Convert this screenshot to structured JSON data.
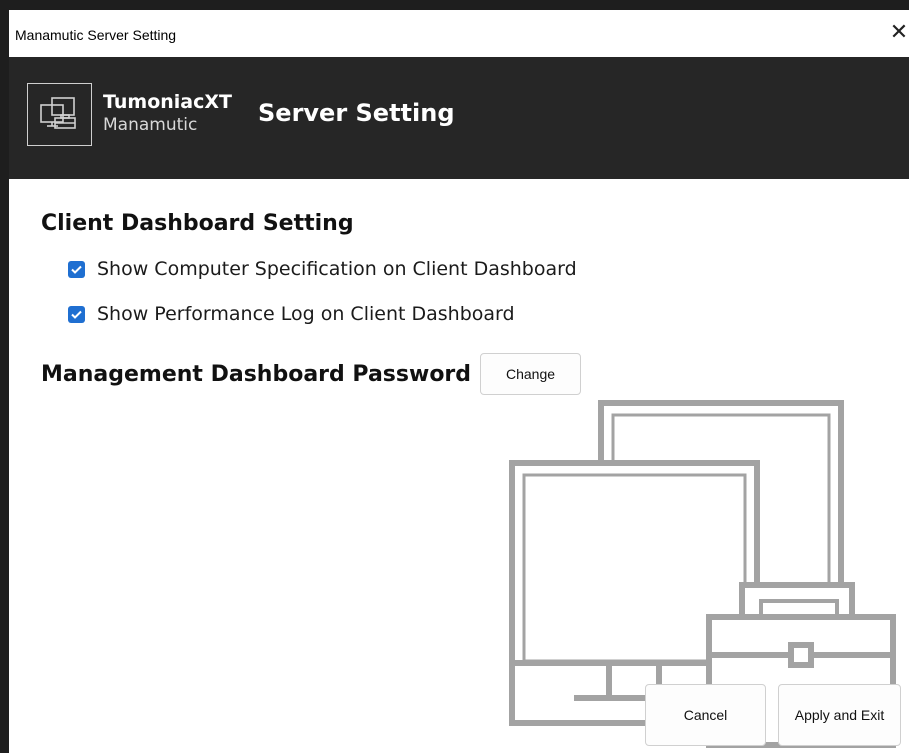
{
  "window": {
    "title": "Manamutic Server Setting",
    "close_icon": "close-icon"
  },
  "header": {
    "logo_icon": "computers-briefcase-icon",
    "brand_main": "TumoniacXT",
    "brand_sub": "Manamutic",
    "title": "Server Setting"
  },
  "client_dashboard": {
    "heading": "Client Dashboard Setting",
    "options": [
      {
        "label": "Show Computer Specification on Client Dashboard",
        "checked": true
      },
      {
        "label": "Show Performance Log on Client Dashboard",
        "checked": true
      }
    ]
  },
  "management": {
    "heading": "Management Dashboard Password",
    "change_label": "Change"
  },
  "footer": {
    "cancel_label": "Cancel",
    "apply_label": "Apply and Exit"
  },
  "colors": {
    "header_bg": "#262626",
    "checkbox_accent": "#1f6fd1",
    "illustration_stroke": "#a3a3a3"
  }
}
